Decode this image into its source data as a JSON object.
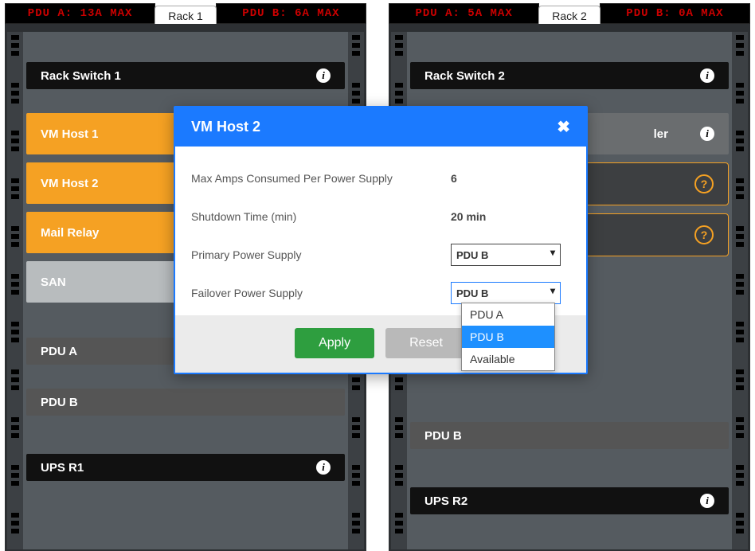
{
  "rack1": {
    "tab": "Rack 1",
    "pdu_a": "PDU A: 13A MAX",
    "pdu_b": "PDU B: 6A MAX",
    "switch": "Rack Switch 1",
    "vm1": "VM Host 1",
    "vm2": "VM Host 2",
    "mail": "Mail Relay",
    "san": "SAN",
    "pduA_label": "PDU A",
    "pduB_label": "PDU B",
    "ups": "UPS R1"
  },
  "rack2": {
    "tab": "Rack 2",
    "pdu_a": "PDU A: 5A MAX",
    "pdu_b": "PDU B: 0A MAX",
    "switch": "Rack Switch 2",
    "controller_suffix": "ler",
    "pduB_label": "PDU B",
    "ups": "UPS R2"
  },
  "modal": {
    "title": "VM Host 2",
    "max_amps_label": "Max Amps Consumed Per Power Supply",
    "max_amps_value": "6",
    "shutdown_label": "Shutdown Time (min)",
    "shutdown_value": "20 min",
    "primary_label": "Primary Power Supply",
    "primary_value": "PDU B",
    "failover_label": "Failover Power Supply",
    "failover_value": "PDU B",
    "apply": "Apply",
    "reset": "Reset",
    "options": {
      "a": "PDU A",
      "b": "PDU B",
      "avail": "Available"
    }
  }
}
